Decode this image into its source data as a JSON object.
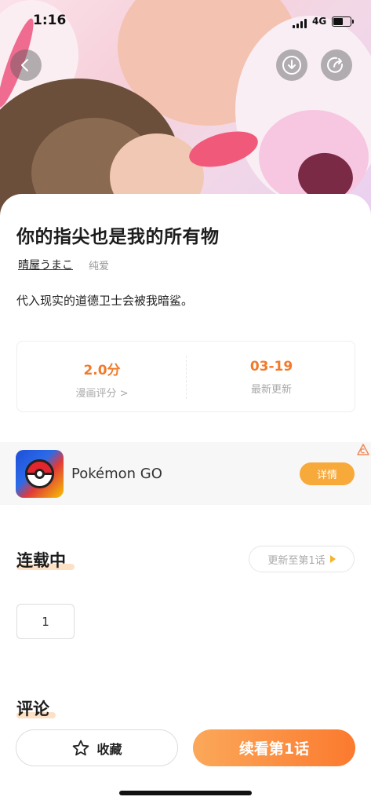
{
  "status_bar": {
    "time": "1:16",
    "network": "4G",
    "battery_level": 0.6
  },
  "header": {
    "back_icon": "chevron-left-icon",
    "download_icon": "download-icon",
    "share_icon": "share-icon"
  },
  "comic": {
    "title": "你的指尖也是我的所有物",
    "author": "晴屋うまこ",
    "genre": "纯爱",
    "description": "代入现实的道德卫士会被我暗鲨。"
  },
  "stats": {
    "rating_value": "2.0分",
    "rating_label": "漫画评分 >",
    "update_value": "03-19",
    "update_label": "最新更新"
  },
  "ad": {
    "app_name": "Pokémon GO",
    "detail_label": "详情"
  },
  "serial": {
    "status": "连载中",
    "update_pill": "更新至第1话",
    "chapters": [
      "1"
    ]
  },
  "comments": {
    "title": "评论"
  },
  "bottom": {
    "favorite_label": "收藏",
    "read_label": "续看第1话"
  },
  "colors": {
    "accent": "#f27a2b",
    "button_gradient_start": "#fba85a",
    "button_gradient_end": "#fb7a2e",
    "detail_button": "#f7a93a"
  }
}
